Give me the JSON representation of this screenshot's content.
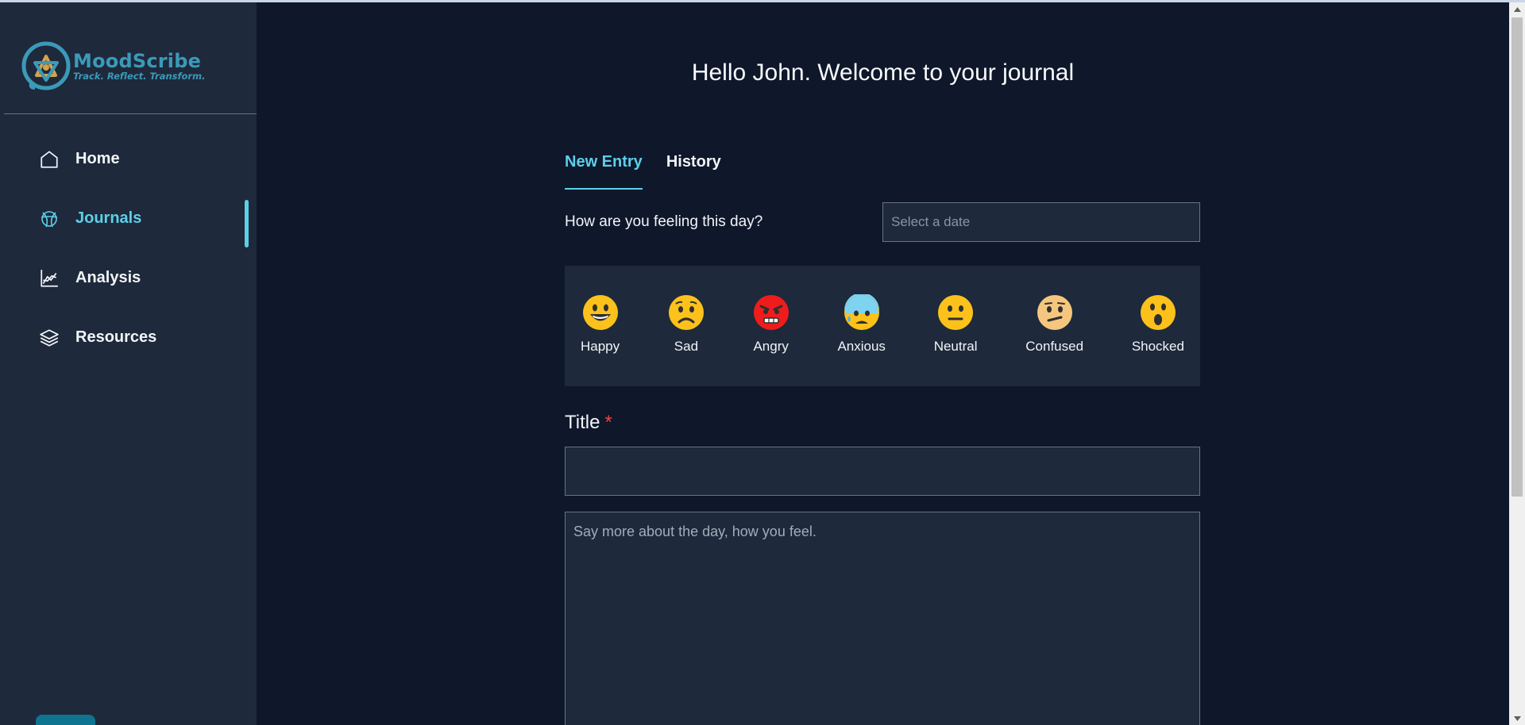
{
  "app": {
    "name": "MoodScribe",
    "tagline": "Track. Reflect. Transform."
  },
  "sidebar": {
    "items": [
      {
        "label": "Home",
        "icon": "home-icon",
        "active": false
      },
      {
        "label": "Journals",
        "icon": "journal-icon",
        "active": true
      },
      {
        "label": "Analysis",
        "icon": "chart-icon",
        "active": false
      },
      {
        "label": "Resources",
        "icon": "layers-icon",
        "active": false
      }
    ]
  },
  "header": {
    "welcome": "Hello John. Welcome to your journal"
  },
  "tabs": [
    {
      "label": "New Entry",
      "active": true
    },
    {
      "label": "History",
      "active": false
    }
  ],
  "entry": {
    "feeling_label": "How are you feeling this day?",
    "date_placeholder": "Select a date",
    "moods": [
      {
        "label": "Happy",
        "icon": "happy-face-icon"
      },
      {
        "label": "Sad",
        "icon": "sad-face-icon"
      },
      {
        "label": "Angry",
        "icon": "angry-face-icon"
      },
      {
        "label": "Anxious",
        "icon": "anxious-face-icon"
      },
      {
        "label": "Neutral",
        "icon": "neutral-face-icon"
      },
      {
        "label": "Confused",
        "icon": "confused-face-icon"
      },
      {
        "label": "Shocked",
        "icon": "shocked-face-icon"
      }
    ],
    "title_label": "Title",
    "required_mark": "*",
    "title_value": "",
    "body_placeholder": "Say more about the day, how you feel."
  },
  "colors": {
    "accent": "#5ecfe8",
    "brand": "#3b9ab8",
    "background": "#0f172a",
    "panel": "#1e293b",
    "required": "#ef4444"
  }
}
